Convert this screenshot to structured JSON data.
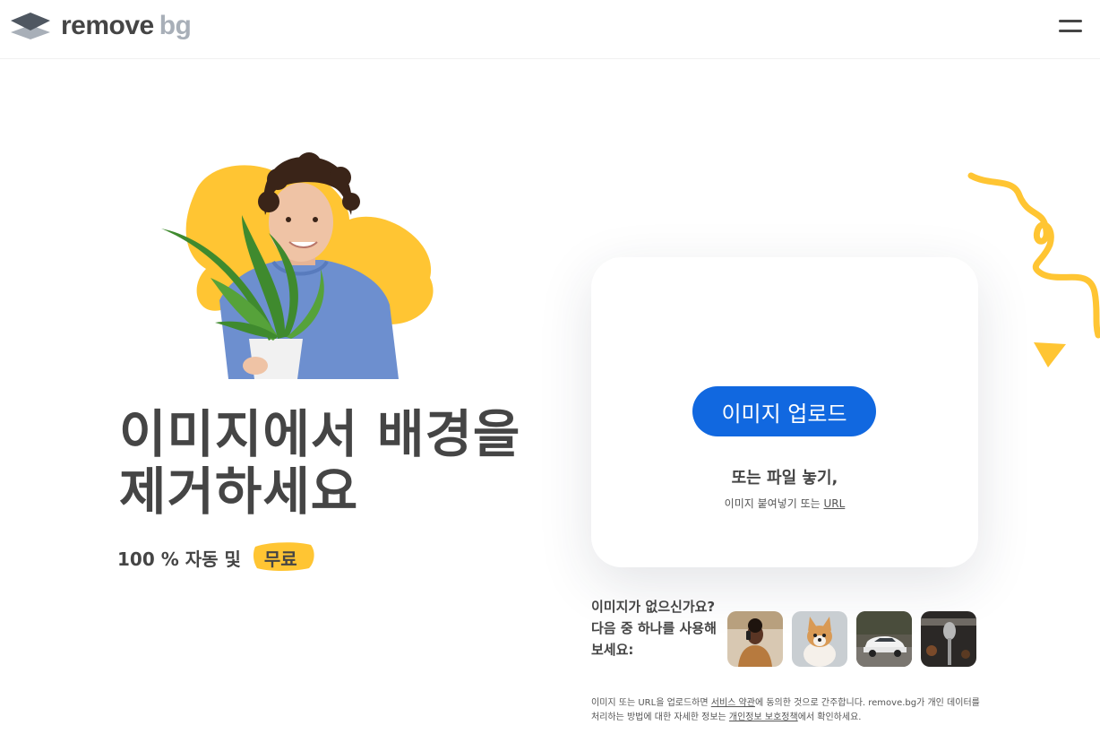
{
  "header": {
    "logo_word_1": "remove",
    "logo_word_2": "bg",
    "menu_icon": "hamburger-menu-icon"
  },
  "hero": {
    "headline": "이미지에서 배경을 제거하세요",
    "subline_prefix": "100 % 자동 및",
    "subline_badge": "무료",
    "image_icon": "person-holding-plant-image"
  },
  "upload": {
    "button_label": "이미지 업로드",
    "drop_text": "또는 파일 놓기,",
    "paste_text": "이미지 붙여넣기 또는",
    "url_link": "URL"
  },
  "samples": {
    "prompt_line1": "이미지가 없으신가요?",
    "prompt_line2": "다음 중 하나를 사용해 보세요:",
    "thumbnails": [
      "person-on-phone-thumbnail",
      "corgi-dog-thumbnail",
      "white-car-thumbnail",
      "microphone-thumbnail"
    ]
  },
  "legal": {
    "part1": "이미지 또는 URL을 업로드하면 ",
    "terms_link": "서비스 약관",
    "part2": "에 동의한 것으로 간주합니다. remove.bg가 개인 데이터를 처리하는 방법에 대한 자세한 정보는 ",
    "privacy_link": "개인정보 보호정책",
    "part3": "에서 확인하세요."
  },
  "colors": {
    "accent_blue": "#1168e0",
    "brand_yellow": "#ffc533",
    "text_dark": "#454545",
    "logo_gray": "#a8afb8"
  }
}
